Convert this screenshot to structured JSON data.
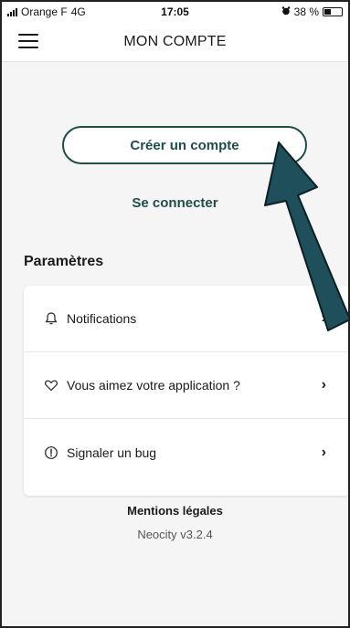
{
  "status_bar": {
    "carrier": "Orange F",
    "network": "4G",
    "time": "17:05",
    "battery_percent": "38 %",
    "alarm_icon": "alarm-icon",
    "battery_level": 0.38
  },
  "header": {
    "title": "MON COMPTE",
    "menu_icon": "hamburger-menu-icon"
  },
  "account": {
    "create_label": "Créer un compte",
    "login_label": "Se connecter"
  },
  "settings": {
    "title": "Paramètres",
    "items": [
      {
        "label": "Notifications",
        "icon": "bell-icon",
        "chevron": "›"
      },
      {
        "label": "Vous aimez votre application ?",
        "icon": "heart-icon",
        "chevron": "›"
      },
      {
        "label": "Signaler un bug",
        "icon": "warning-circle-icon",
        "chevron": "›"
      }
    ]
  },
  "footer": {
    "legal_label": "Mentions légales",
    "version": "Neocity v3.2.4"
  },
  "annotation": {
    "arrow_color": "#1e4f5a",
    "arrow_icon": "annotation-arrow-icon"
  },
  "colors": {
    "accent": "#1f4d47",
    "background": "#f5f5f5",
    "card": "#ffffff"
  }
}
